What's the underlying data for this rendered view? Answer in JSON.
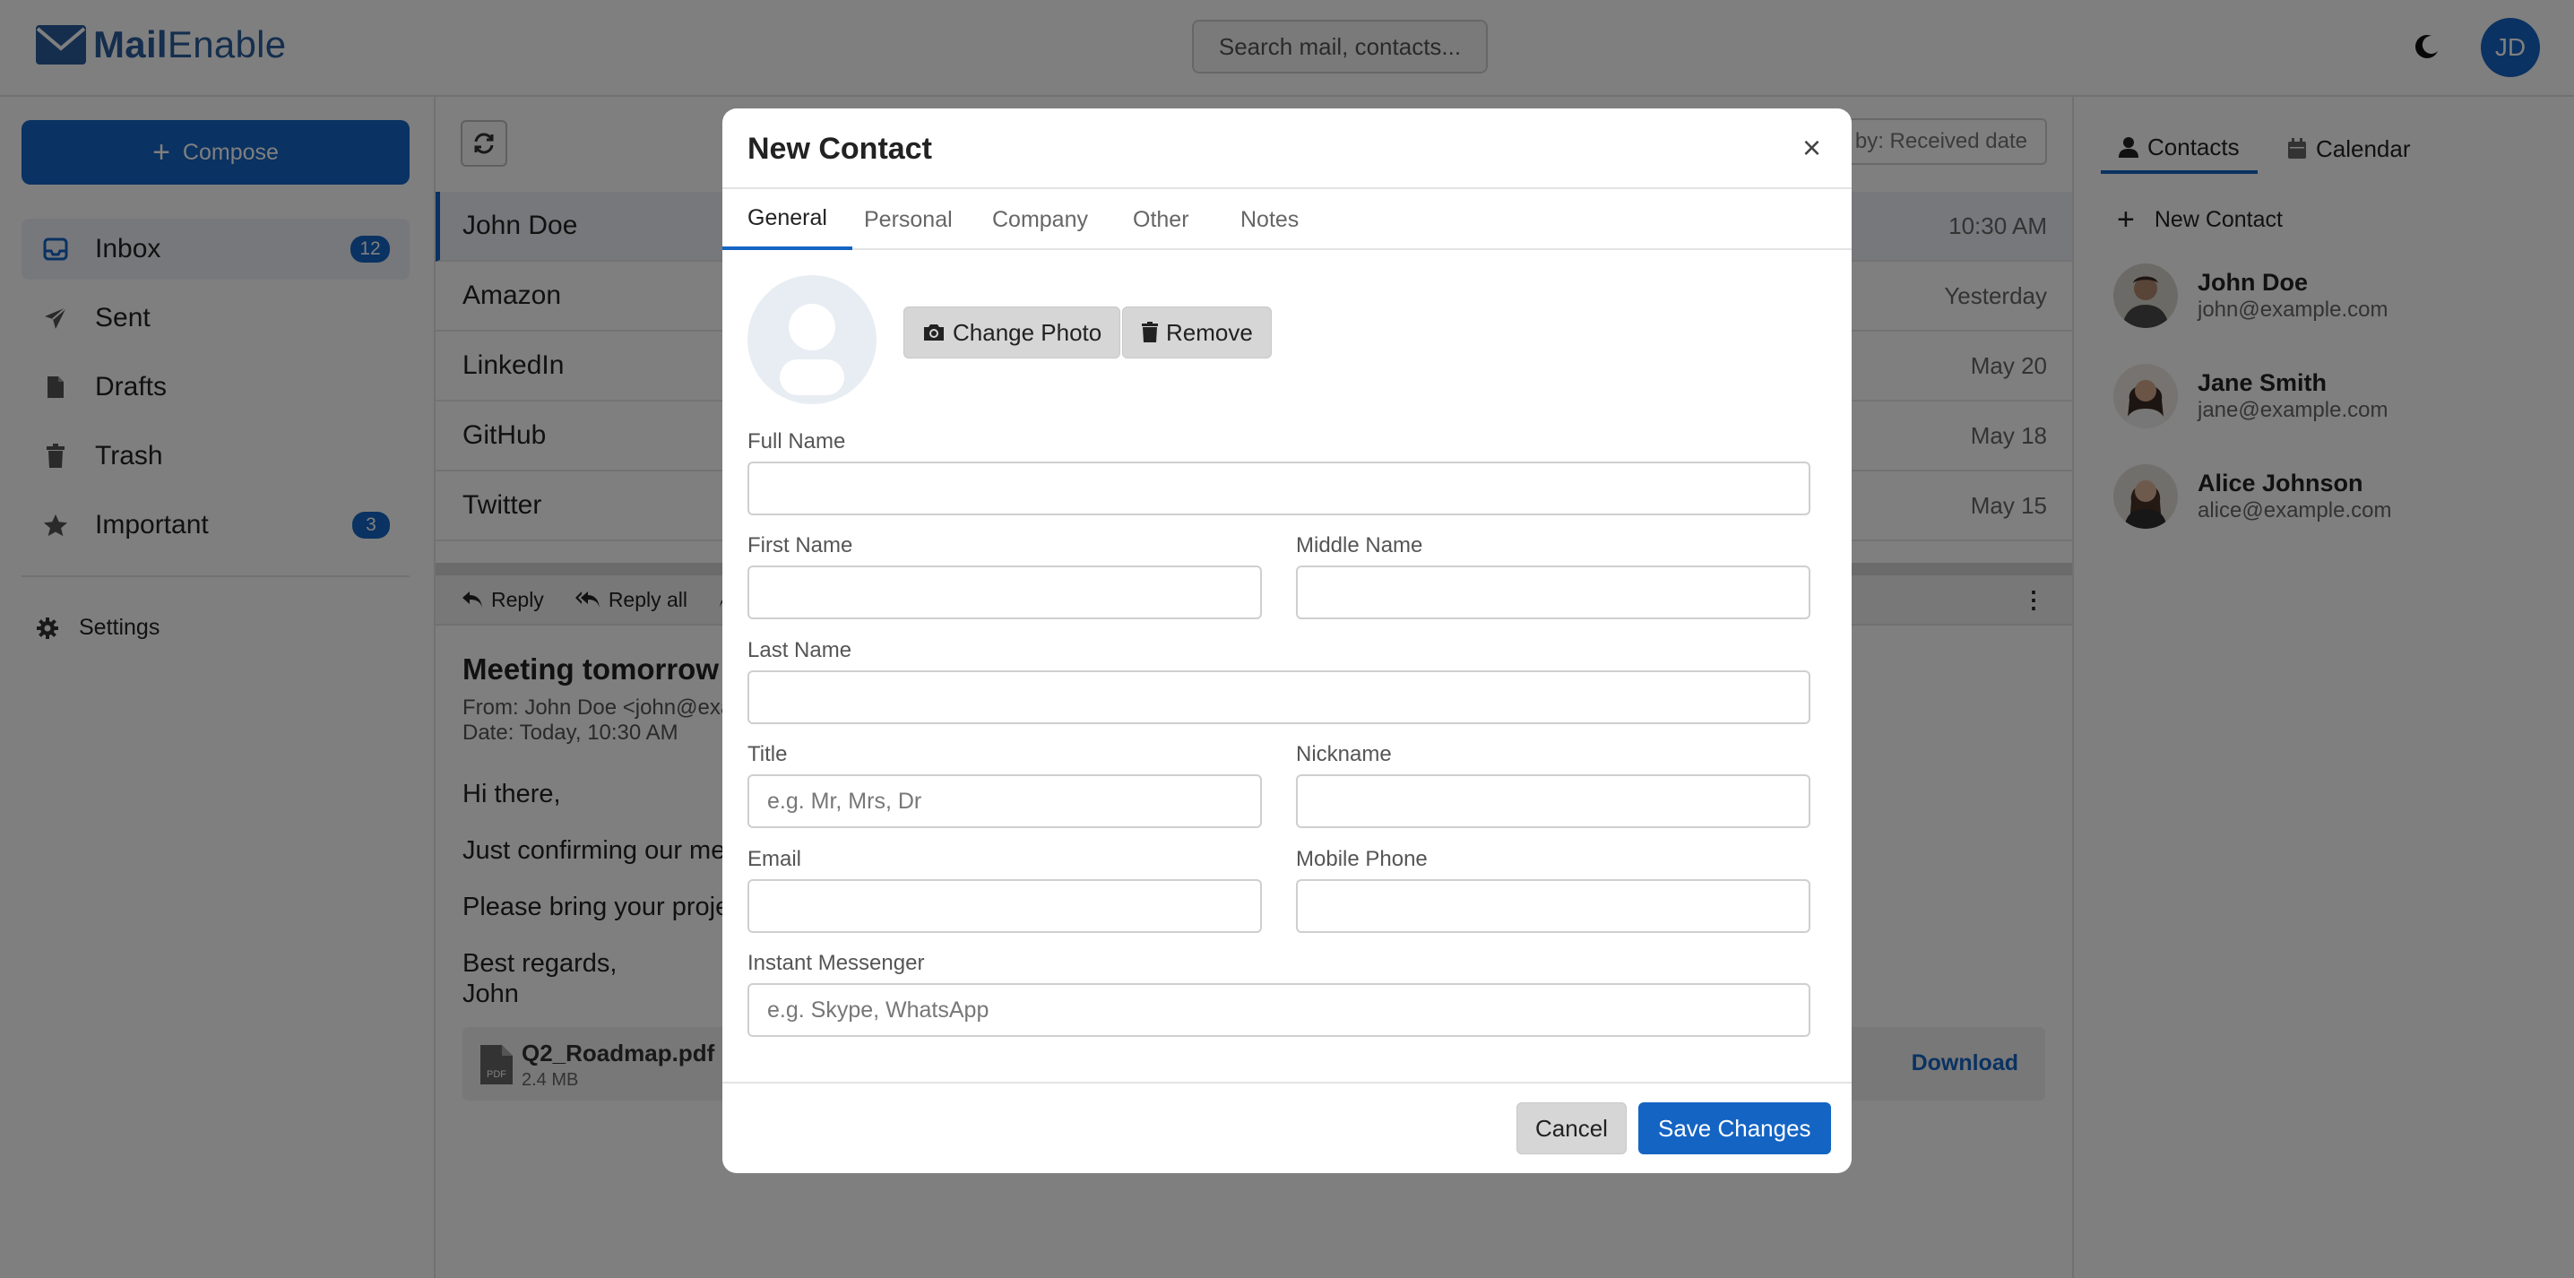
{
  "app": {
    "logo_prefix": "Mail",
    "logo_suffix": "Enable",
    "search_placeholder": "Search mail, contacts...",
    "user_initials": "JD",
    "accent_color": "#1464c4"
  },
  "sidebar": {
    "compose_label": "Compose",
    "items": [
      {
        "label": "Inbox",
        "icon": "inbox-icon",
        "badge": "12"
      },
      {
        "label": "Sent",
        "icon": "paper-plane-icon",
        "badge": ""
      },
      {
        "label": "Drafts",
        "icon": "file-icon",
        "badge": ""
      },
      {
        "label": "Trash",
        "icon": "trash-icon",
        "badge": ""
      },
      {
        "label": "Important",
        "icon": "star-icon",
        "badge": "3"
      }
    ],
    "settings_label": "Settings"
  },
  "maillist": {
    "sort_label": "Sort by: Received date",
    "rows": [
      {
        "sender": "John Doe",
        "time": "10:30 AM"
      },
      {
        "sender": "Amazon",
        "time": "Yesterday"
      },
      {
        "sender": "LinkedIn",
        "time": "May 20"
      },
      {
        "sender": "GitHub",
        "time": "May 18"
      },
      {
        "sender": "Twitter",
        "time": "May 15"
      }
    ]
  },
  "reader": {
    "toolbar": {
      "reply": "Reply",
      "reply_all": "Reply all"
    },
    "subject": "Meeting tomorrow",
    "from": "From: John Doe <john@exa",
    "date": "Date: Today, 10:30 AM",
    "body": [
      "Hi there,",
      "Just confirming our me",
      "Please bring your proje",
      "Best regards,",
      "John"
    ],
    "attachment": {
      "name": "Q2_Roadmap.pdf",
      "size": "2.4 MB",
      "download_label": "Download"
    }
  },
  "rightpanel": {
    "tabs": [
      "Contacts",
      "Calendar"
    ],
    "new_contact_label": "New Contact",
    "contacts": [
      {
        "name": "John Doe",
        "email": "john@example.com"
      },
      {
        "name": "Jane Smith",
        "email": "jane@example.com"
      },
      {
        "name": "Alice Johnson",
        "email": "alice@example.com"
      }
    ]
  },
  "modal": {
    "title": "New Contact",
    "close_glyph": "×",
    "tabs": [
      "General",
      "Personal",
      "Company",
      "Other",
      "Notes"
    ],
    "change_photo_label": "Change Photo",
    "remove_label": "Remove",
    "fields": {
      "full_name": {
        "label": "Full Name",
        "value": "",
        "placeholder": ""
      },
      "first_name": {
        "label": "First Name",
        "value": "",
        "placeholder": ""
      },
      "middle_name": {
        "label": "Middle Name",
        "value": "",
        "placeholder": ""
      },
      "last_name": {
        "label": "Last Name",
        "value": "",
        "placeholder": ""
      },
      "title": {
        "label": "Title",
        "value": "",
        "placeholder": "e.g. Mr, Mrs, Dr"
      },
      "nickname": {
        "label": "Nickname",
        "value": "",
        "placeholder": ""
      },
      "email": {
        "label": "Email",
        "value": "",
        "placeholder": ""
      },
      "mobile_phone": {
        "label": "Mobile Phone",
        "value": "",
        "placeholder": ""
      },
      "instant_messenger": {
        "label": "Instant Messenger",
        "value": "",
        "placeholder": "e.g. Skype, WhatsApp"
      }
    },
    "cancel_label": "Cancel",
    "save_label": "Save Changes"
  }
}
